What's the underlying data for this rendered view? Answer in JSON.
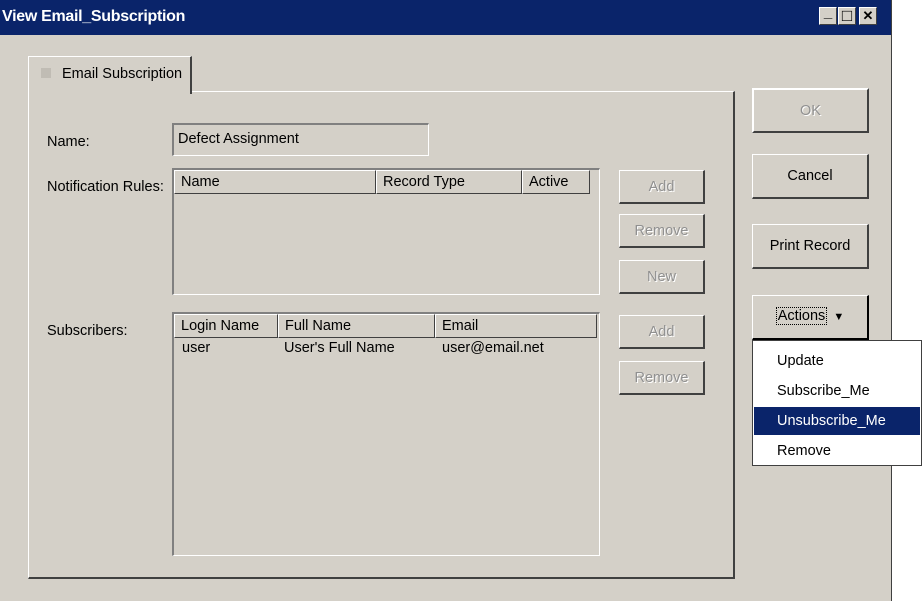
{
  "window": {
    "title": "View Email_Subscription"
  },
  "titlebar_buttons": {
    "minimize": "_",
    "maximize": "□",
    "close": "✕"
  },
  "tab": {
    "label": "Email Subscription"
  },
  "fields": {
    "name_label": "Name:",
    "name_value": "Defect Assignment",
    "notification_rules_label": "Notification Rules:",
    "subscribers_label": "Subscribers:"
  },
  "notification_rules": {
    "columns": [
      "Name",
      "Record Type",
      "Active"
    ],
    "rows": []
  },
  "subscribers": {
    "columns": [
      "Login Name",
      "Full Name",
      "Email"
    ],
    "rows": [
      [
        "user",
        "User's Full Name",
        "user@email.net"
      ]
    ]
  },
  "rules_buttons": {
    "add": "Add",
    "remove": "Remove",
    "new": "New"
  },
  "subscribers_buttons": {
    "add": "Add",
    "remove": "Remove"
  },
  "dialog_buttons": {
    "ok": "OK",
    "cancel": "Cancel",
    "print": "Print Record",
    "actions": "Actions",
    "actions_arrow": "▼"
  },
  "actions_menu": {
    "items": [
      "Update",
      "Subscribe_Me",
      "Unsubscribe_Me",
      "Remove"
    ],
    "highlighted": "Unsubscribe_Me"
  }
}
